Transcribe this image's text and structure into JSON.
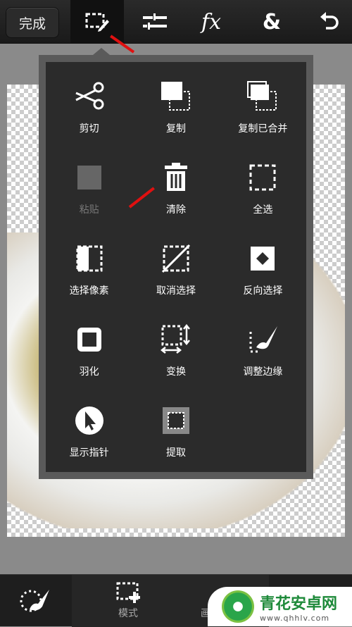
{
  "toolbar": {
    "done_label": "完成",
    "tools": [
      {
        "name": "selection-tool",
        "icon": "selection-edit-icon",
        "active": true
      },
      {
        "name": "adjust-tool",
        "icon": "sliders-icon"
      },
      {
        "name": "effects-tool",
        "icon": "fx-icon",
        "label": "fx"
      },
      {
        "name": "layers-tool",
        "icon": "ampersand-icon",
        "label": "&"
      },
      {
        "name": "undo-tool",
        "icon": "undo-icon"
      }
    ]
  },
  "menu": {
    "items": [
      {
        "label": "剪切",
        "icon": "scissors-icon"
      },
      {
        "label": "复制",
        "icon": "copy-icon"
      },
      {
        "label": "复制已合并",
        "icon": "copy-merged-icon"
      },
      {
        "label": "粘贴",
        "icon": "paste-icon",
        "disabled": true
      },
      {
        "label": "清除",
        "icon": "trash-icon"
      },
      {
        "label": "全选",
        "icon": "select-all-icon"
      },
      {
        "label": "选择像素",
        "icon": "select-pixels-icon"
      },
      {
        "label": "取消选择",
        "icon": "deselect-icon"
      },
      {
        "label": "反向选择",
        "icon": "invert-selection-icon"
      },
      {
        "label": "羽化",
        "icon": "feather-icon"
      },
      {
        "label": "变换",
        "icon": "transform-icon"
      },
      {
        "label": "调整边缘",
        "icon": "refine-edge-icon"
      },
      {
        "label": "显示指针",
        "icon": "pointer-icon"
      },
      {
        "label": "提取",
        "icon": "extract-icon"
      }
    ]
  },
  "bottombar": {
    "mode_label": "模式",
    "partial_label": "画"
  },
  "watermark": {
    "title": "青花安卓网",
    "url": "www.qhhlv.com"
  },
  "colors": {
    "annotation_arrow": "#e01010",
    "toolbar": "#1e1e1e",
    "menu": "#2b2b2b"
  }
}
